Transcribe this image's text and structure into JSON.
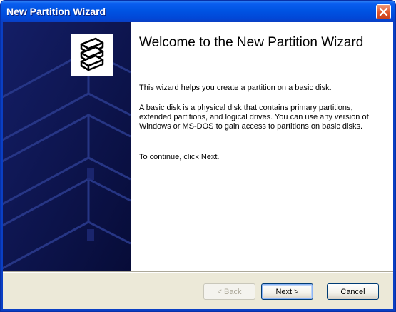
{
  "window": {
    "title": "New Partition Wizard"
  },
  "wizard": {
    "heading": "Welcome to the New Partition Wizard",
    "intro": "This wizard helps you create a partition on a basic disk.",
    "description": "A basic disk is a physical disk that contains primary partitions, extended partitions, and logical drives. You can use any version of Windows or MS-DOS to gain access to partitions on basic disks.",
    "continue_text": "To continue, click Next."
  },
  "buttons": {
    "back": "< Back",
    "next": "Next >",
    "cancel": "Cancel"
  },
  "icons": {
    "close": "close-icon",
    "logo": "stacked-disks-icon"
  },
  "colors": {
    "titlebar": "#0054e3",
    "side_panel": "#0c1550",
    "close_button": "#e0552a"
  }
}
